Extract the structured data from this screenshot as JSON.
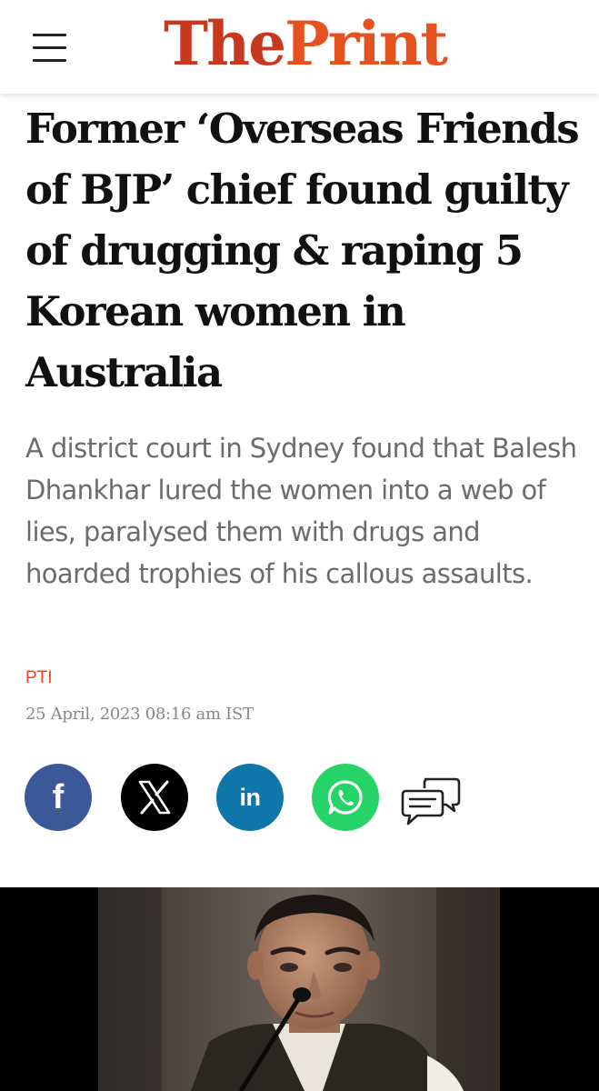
{
  "header": {
    "brand_part1": "The",
    "brand_part2": "Print",
    "menu_icon": "hamburger-menu-icon"
  },
  "article": {
    "headline": "Former ‘Overseas Friends of BJP’ chief found guilty of drugging & raping 5 Korean women in Australia",
    "dek": "A district court in Sydney found that Balesh Dhankhar lured the women into a web of lies, paralysed them with drugs and hoarded trophies of his callous assaults.",
    "author": "PTI",
    "dateline": "25 April, 2023 08:16 am IST"
  },
  "share": {
    "buttons": [
      {
        "icon": "facebook-icon",
        "color": "#3b5998"
      },
      {
        "icon": "x-icon",
        "color": "#000000"
      },
      {
        "icon": "linkedin-icon",
        "color": "#0e76a8"
      },
      {
        "icon": "whatsapp-icon",
        "color": "#25d366"
      },
      {
        "icon": "comments-icon",
        "color": "#222222"
      }
    ]
  },
  "colors": {
    "brand_red": "#c8381e",
    "brand_orange": "#e5521f",
    "author_link": "#e04a22",
    "dek_gray": "#6c6c6c"
  }
}
